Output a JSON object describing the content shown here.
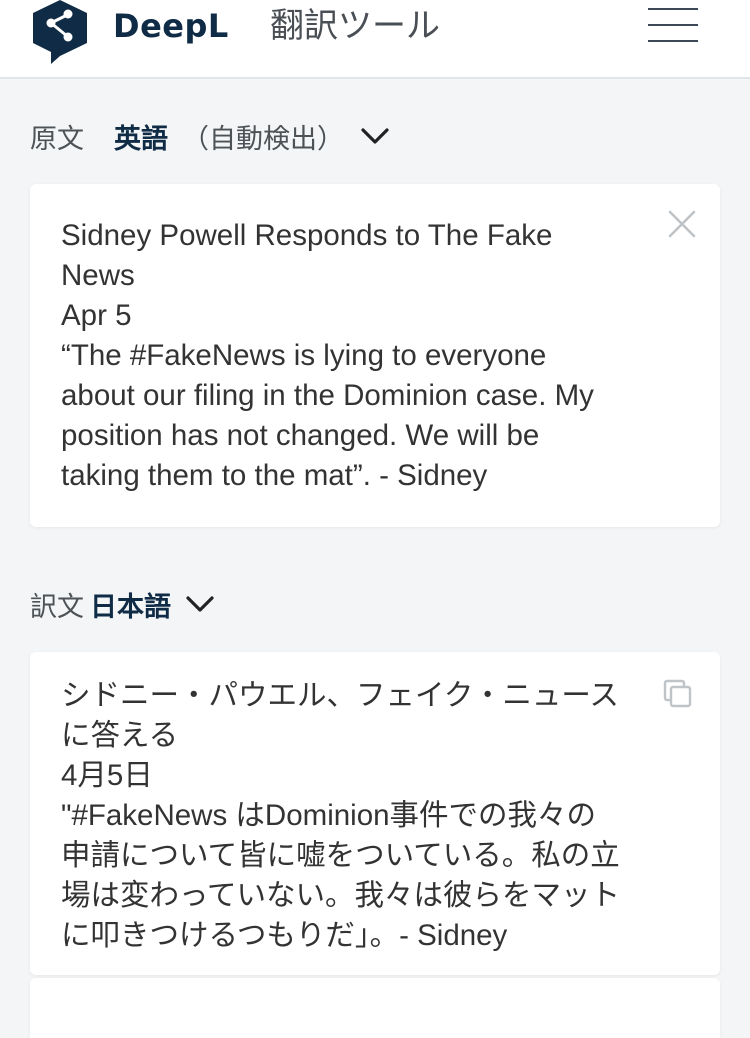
{
  "header": {
    "brand": "DeepL",
    "product": "翻訳ツール",
    "icons": {
      "logo": "deepl-logo",
      "menu": "hamburger-menu-icon"
    }
  },
  "source": {
    "label": "原文",
    "language": "英語",
    "detect": "（自動検出）",
    "lines": [
      "Sidney Powell Responds to The Fake",
      "News",
      "Apr 5",
      "“The #FakeNews is lying to everyone",
      "about our filing in the Dominion case. My",
      "position has not changed. We will be",
      "taking them to the mat”. - Sidney"
    ]
  },
  "target": {
    "label": "訳文",
    "language": "日本語",
    "lines": [
      "シドニー・パウエル、フェイク・ニュース",
      "に答える",
      "4月5日",
      "\"#FakeNews はDominion事件での我々の",
      "申請について皆に嘘をついている。私の立",
      "場は変わっていない。我々は彼らをマット",
      "に叩きつけるつもりだ」。- Sidney"
    ]
  },
  "colors": {
    "brand_navy": "#0f2b46",
    "page_bg": "#f3f5f6",
    "card_bg": "#ffffff",
    "muted_icon": "#bfc4c9"
  }
}
